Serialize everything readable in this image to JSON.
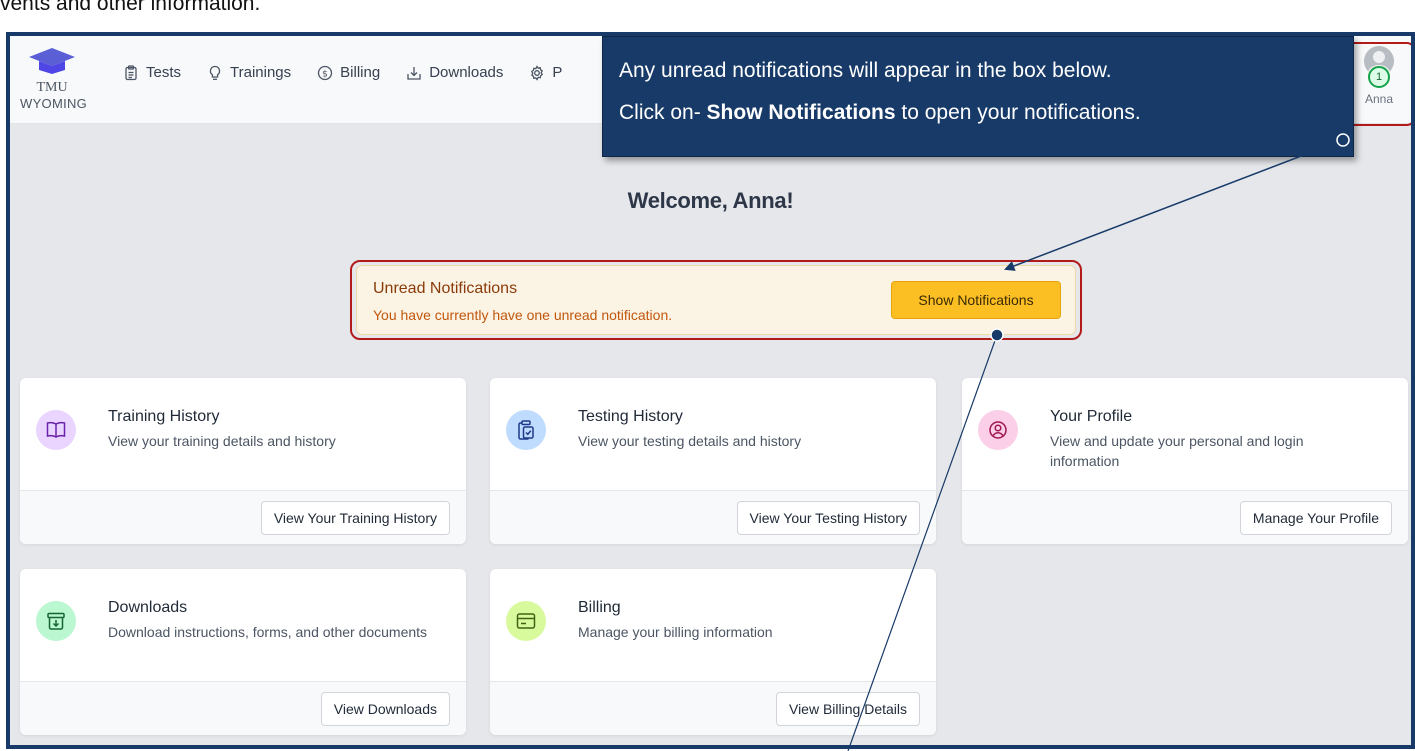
{
  "doc_text": "vents and other information.",
  "app": {
    "logo_line1": "TMU",
    "logo_line2": "WYOMING"
  },
  "nav": [
    {
      "label": "Tests",
      "icon": "clipboard-icon"
    },
    {
      "label": "Trainings",
      "icon": "lightbulb-icon"
    },
    {
      "label": "Billing",
      "icon": "dollar-circle-icon"
    },
    {
      "label": "Downloads",
      "icon": "download-tray-icon"
    },
    {
      "label": "P",
      "icon": "gear-icon"
    }
  ],
  "user": {
    "name": "Anna",
    "badge_count": "1"
  },
  "welcome": "Welcome, Anna!",
  "notice": {
    "title": "Unread Notifications",
    "message": "You have currently have one unread notification.",
    "button": "Show Notifications"
  },
  "cards": [
    {
      "title": "Training History",
      "desc": "View your training details and history",
      "button": "View Your Training History",
      "icon": "book-icon",
      "color": "#e9d5ff"
    },
    {
      "title": "Testing History",
      "desc": "View your testing details and history",
      "button": "View Your Testing History",
      "icon": "clipboard-check-icon",
      "color": "#bfdbfe"
    },
    {
      "title": "Your Profile",
      "desc": "View and update your personal and login information",
      "button": "Manage Your Profile",
      "icon": "user-circle-icon",
      "color": "#fbcfe8"
    },
    {
      "title": "Downloads",
      "desc": "Download instructions, forms, and other documents",
      "button": "View Downloads",
      "icon": "archive-download-icon",
      "color": "#bbf7d0"
    },
    {
      "title": "Billing",
      "desc": "Manage your billing information",
      "button": "View Billing Details",
      "icon": "credit-card-icon",
      "color": "#d9f99d"
    }
  ],
  "callout": {
    "line1": "Any unread notifications will appear in the box below.",
    "line2_prefix": "Click on- ",
    "line2_bold": "Show Notifications",
    "line2_suffix": " to open your notifications."
  },
  "colors": {
    "frame": "#173a68",
    "highlight": "#b31b1b",
    "notice_bg": "#fbf3e4",
    "notice_button": "#fbbf24",
    "callout_bg": "#173a68"
  }
}
